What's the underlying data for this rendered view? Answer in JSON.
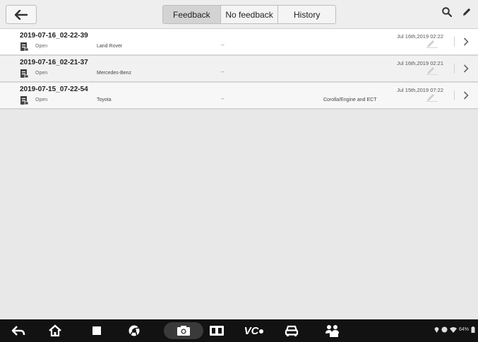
{
  "tabs": [
    {
      "label": "Feedback",
      "active": true
    },
    {
      "label": "No feedback",
      "active": false
    },
    {
      "label": "History",
      "active": false
    }
  ],
  "icons": {
    "back": "back-arrow-icon",
    "search": "search-icon",
    "edit": "edit-pencil-icon"
  },
  "records": [
    {
      "title": "2019-07-16_02-22-39",
      "status": "Open",
      "brand": "Land Rover",
      "detail": "--",
      "system": "",
      "date": "Jul 16th,2019 02:22"
    },
    {
      "title": "2019-07-16_02-21-37",
      "status": "Open",
      "brand": "Mercedes-Benz",
      "detail": "--",
      "system": "",
      "date": "Jul 16th,2019 02:21"
    },
    {
      "title": "2019-07-15_07-22-54",
      "status": "Open",
      "brand": "Toyota",
      "detail": "--",
      "system": "Corolla/Engine and ECT",
      "date": "Jul 15th,2019 07:22"
    }
  ],
  "navbar": {
    "vc_label": "VC",
    "battery_text": "64%",
    "items": [
      "back-icon",
      "home-icon",
      "recent-apps-icon",
      "browser-icon",
      "camera-icon",
      "display-icon",
      "vci-icon",
      "car-icon",
      "remote-expert-icon"
    ]
  },
  "colors": {
    "background": "#e8e8e8",
    "active_tab": "#d3d3d3",
    "navbar": "#121212"
  }
}
